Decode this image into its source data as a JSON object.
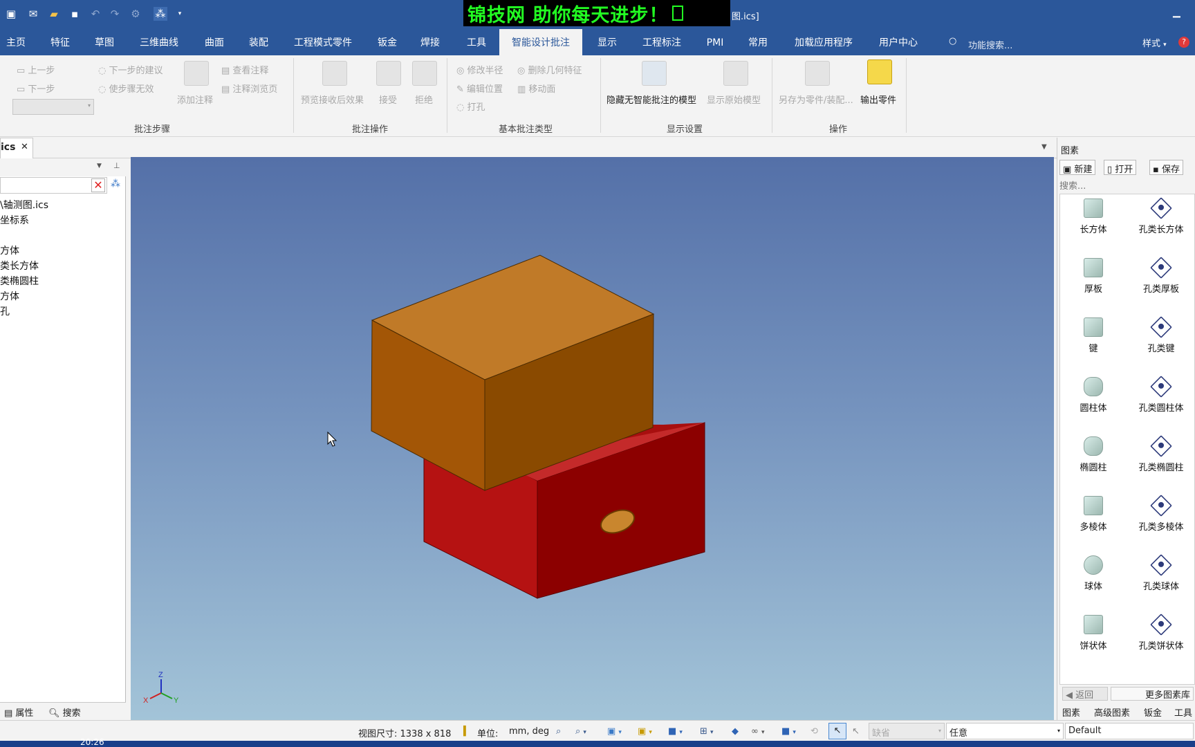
{
  "titlebar": {
    "banner": "锦技网 助你每天进步！",
    "title": "图.ics]"
  },
  "menu": {
    "tabs": [
      "主页",
      "特征",
      "草图",
      "三维曲线",
      "曲面",
      "装配",
      "工程模式零件",
      "钣金",
      "焊接",
      "工具",
      "智能设计批注",
      "显示",
      "工程标注",
      "PMI",
      "常用",
      "加载应用程序",
      "用户中心"
    ],
    "active_tab": "智能设计批注",
    "search_placeholder": "功能搜索...",
    "style_label": "样式"
  },
  "ribbon": {
    "groups": {
      "steps": {
        "label": "批注步骤",
        "prev": "上一步",
        "next": "下一步",
        "next_suggestion": "下一步的建议",
        "invalidate_step": "使步骤无效",
        "add_annotation": "添加注释",
        "view_annotation": "查看注释",
        "annotation_browser": "注释浏览页"
      },
      "ops": {
        "label": "批注操作",
        "preview": "预览接收后效果",
        "accept": "接受",
        "reject": "拒绝"
      },
      "basic": {
        "label": "基本批注类型",
        "modify_radius": "修改半径",
        "delete_geometry": "删除几何特征",
        "edit_position": "编辑位置",
        "move_face": "移动面",
        "punch": "打孔"
      },
      "display": {
        "label": "显示设置",
        "hide_model": "隐藏无智能批注的模型",
        "show_original": "显示原始模型"
      },
      "actions": {
        "label": "操作",
        "save_as": "另存为零件/装配...",
        "output_part": "输出零件"
      }
    }
  },
  "document": {
    "tab_label": "ics",
    "close": "✕"
  },
  "tree": {
    "items": [
      "\\轴测图.ics",
      "坐标系",
      "方体",
      "类长方体",
      "类椭圆柱",
      "方体",
      "孔"
    ]
  },
  "left_bottom": {
    "properties": "属性",
    "search": "搜索"
  },
  "right_panel": {
    "title": "图素",
    "new": "新建",
    "open": "打开",
    "save": "保存",
    "search_placeholder": "搜索...",
    "items": [
      {
        "label": "长方体",
        "kind": "solid"
      },
      {
        "label": "孔类长方体",
        "kind": "hole"
      },
      {
        "label": "厚板",
        "kind": "solid"
      },
      {
        "label": "孔类厚板",
        "kind": "hole"
      },
      {
        "label": "键",
        "kind": "solid"
      },
      {
        "label": "孔类键",
        "kind": "hole"
      },
      {
        "label": "圆柱体",
        "kind": "solid"
      },
      {
        "label": "孔类圆柱体",
        "kind": "hole"
      },
      {
        "label": "椭圆柱",
        "kind": "solid"
      },
      {
        "label": "孔类椭圆柱",
        "kind": "hole"
      },
      {
        "label": "多棱体",
        "kind": "solid"
      },
      {
        "label": "孔类多棱体",
        "kind": "hole"
      },
      {
        "label": "球体",
        "kind": "solid"
      },
      {
        "label": "孔类球体",
        "kind": "hole"
      },
      {
        "label": "饼状体",
        "kind": "solid"
      },
      {
        "label": "孔类饼状体",
        "kind": "hole"
      }
    ],
    "back": "返回",
    "more": "更多图素库",
    "tabs": [
      "图素",
      "高级图素",
      "钣金",
      "工具"
    ]
  },
  "status": {
    "view_size": "视图尺寸: 1338 x  818",
    "unit_label": "单位:",
    "unit_value": "mm, deg",
    "default_combo": "缺省",
    "any_combo": "任意",
    "default_combo2": "Default"
  },
  "taskbar": {
    "clock": "20:26"
  },
  "colors": {
    "title_blue": "#2b579a",
    "banner_green": "#22ff22",
    "orange_block": "#c07a28",
    "red_block": "#b51c1c"
  },
  "axes": {
    "x": "X",
    "y": "Y",
    "z": "Z"
  }
}
